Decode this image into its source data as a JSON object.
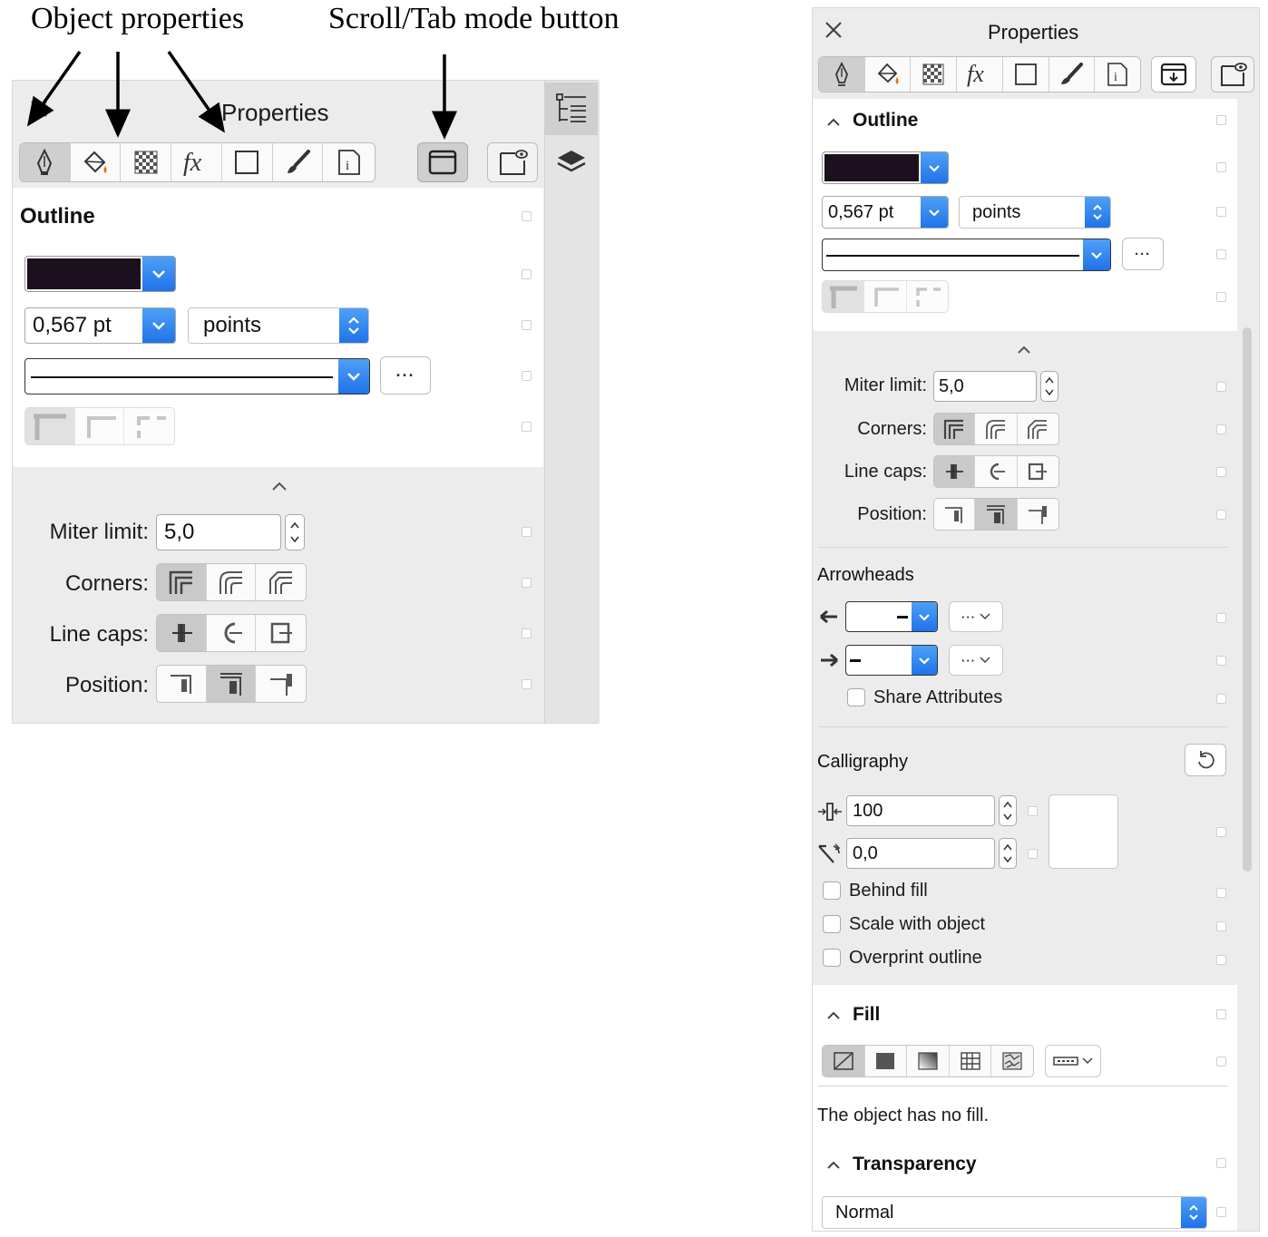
{
  "annotations": {
    "object_properties": "Object properties",
    "scroll_tab_mode": "Scroll/Tab mode button"
  },
  "left_panel": {
    "title": "Properties",
    "section_title": "Outline",
    "width_value": "0,567 pt",
    "unit_value": "points",
    "more": "···",
    "miter_label": "Miter limit:",
    "miter_value": "5,0",
    "corners_label": "Corners:",
    "linecaps_label": "Line caps:",
    "position_label": "Position:",
    "outline_color": "#1c0f1e"
  },
  "right_panel": {
    "title": "Properties",
    "outline": {
      "title": "Outline",
      "width_value": "0,567 pt",
      "unit_value": "points",
      "more": "···",
      "miter_label": "Miter limit:",
      "miter_value": "5,0",
      "corners_label": "Corners:",
      "linecaps_label": "Line caps:",
      "position_label": "Position:"
    },
    "arrowheads": {
      "title": "Arrowheads",
      "more": "···",
      "share": "Share Attributes"
    },
    "calligraphy": {
      "title": "Calligraphy",
      "stretch_value": "100",
      "angle_value": "0,0",
      "behind_fill": "Behind fill",
      "scale_with_object": "Scale with object",
      "overprint_outline": "Overprint outline"
    },
    "fill": {
      "title": "Fill",
      "no_fill_text": "The object has no fill."
    },
    "transparency": {
      "title": "Transparency",
      "mode_value": "Normal"
    }
  },
  "colors": {
    "accent_blue": "#1f73e8",
    "panel_gray": "#ececec",
    "outline_color": "#1c0f1e"
  }
}
